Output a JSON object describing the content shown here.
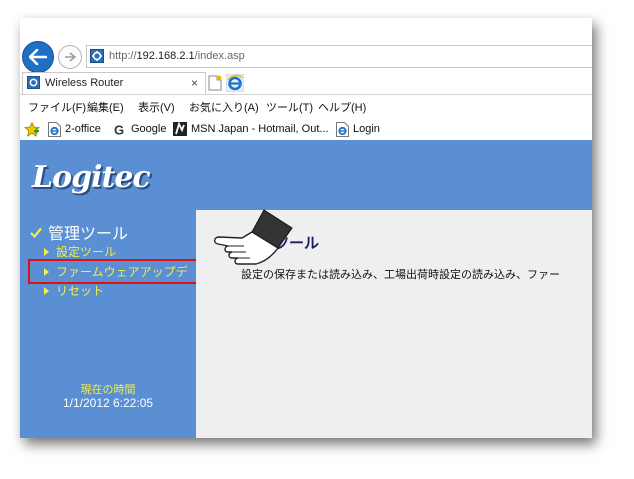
{
  "browser": {
    "url_prefix": "http://",
    "url_host": "192.168.2.1",
    "url_path": "/index.asp",
    "tab_title": "Wireless Router",
    "tab_close": "×",
    "menu": [
      "ファイル(F)",
      "編集(E)",
      "表示(V)",
      "お気に入り(A)",
      "ツール(T)",
      "ヘルプ(H)"
    ],
    "favorites": [
      {
        "label": "2-office",
        "icon": "ie-page-icon"
      },
      {
        "label": "Google",
        "icon": "google-g-icon"
      },
      {
        "label": "MSN Japan - Hotmail, Out...",
        "icon": "msn-icon"
      },
      {
        "label": "Login",
        "icon": "ie-page-icon"
      }
    ]
  },
  "page": {
    "logo": "Logitec",
    "sidebar": {
      "title": "管理ツール",
      "links": [
        "設定ツール",
        "ファームウェアアップデ",
        "リセット"
      ],
      "time_label": "現在の時間",
      "time_value": "1/1/2012 6:22:05"
    },
    "main": {
      "heading": "ツール",
      "description": "設定の保存または読み込み、工場出荷時設定の読み込み、ファー"
    }
  },
  "colors": {
    "page_blue": "#5a8fd3",
    "link_yellow": "#f3ee4a",
    "highlight_red": "#e01010",
    "main_bg": "#efefef"
  }
}
